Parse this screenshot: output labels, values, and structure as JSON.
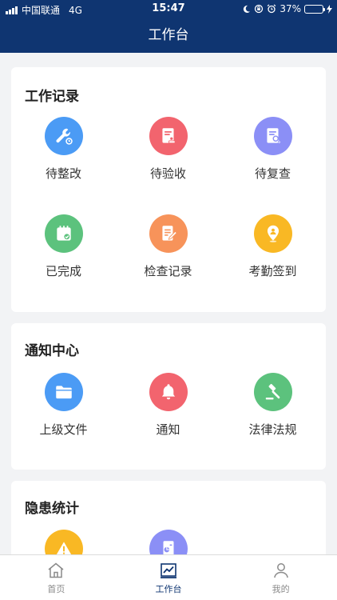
{
  "status_bar": {
    "carrier": "中国联通",
    "network": "4G",
    "time": "15:47",
    "battery": "37%",
    "battery_level": 0.37
  },
  "nav": {
    "title": "工作台"
  },
  "sections": [
    {
      "title": "工作记录",
      "items": [
        {
          "label": "待整改",
          "icon": "wrench-icon",
          "color": "#4b9bf5"
        },
        {
          "label": "待验收",
          "icon": "document-stamp-icon",
          "color": "#f2646e"
        },
        {
          "label": "待复查",
          "icon": "document-search-icon",
          "color": "#8b8ff6"
        },
        {
          "label": "已完成",
          "icon": "calendar-check-icon",
          "color": "#5cc27d"
        },
        {
          "label": "检查记录",
          "icon": "document-edit-icon",
          "color": "#f7935a"
        },
        {
          "label": "考勤签到",
          "icon": "location-pin-icon",
          "color": "#f9b824"
        }
      ]
    },
    {
      "title": "通知中心",
      "items": [
        {
          "label": "上级文件",
          "icon": "folder-icon",
          "color": "#4b9bf5"
        },
        {
          "label": "通知",
          "icon": "bell-icon",
          "color": "#f2646e"
        },
        {
          "label": "法律法规",
          "icon": "gavel-icon",
          "color": "#5cc27d"
        }
      ]
    },
    {
      "title": "隐患统计",
      "items": [
        {
          "label": "",
          "icon": "warning-icon",
          "color": "#f9b824"
        },
        {
          "label": "",
          "icon": "document-stats-icon",
          "color": "#8b8ff6"
        }
      ]
    }
  ],
  "tabbar": [
    {
      "label": "首页",
      "icon": "home-icon",
      "active": false
    },
    {
      "label": "工作台",
      "icon": "chart-icon",
      "active": true
    },
    {
      "label": "我的",
      "icon": "user-icon",
      "active": false
    }
  ],
  "colors": {
    "primary": "#0f3571",
    "background": "#f2f3f5",
    "inactive": "#8a8a8a"
  }
}
